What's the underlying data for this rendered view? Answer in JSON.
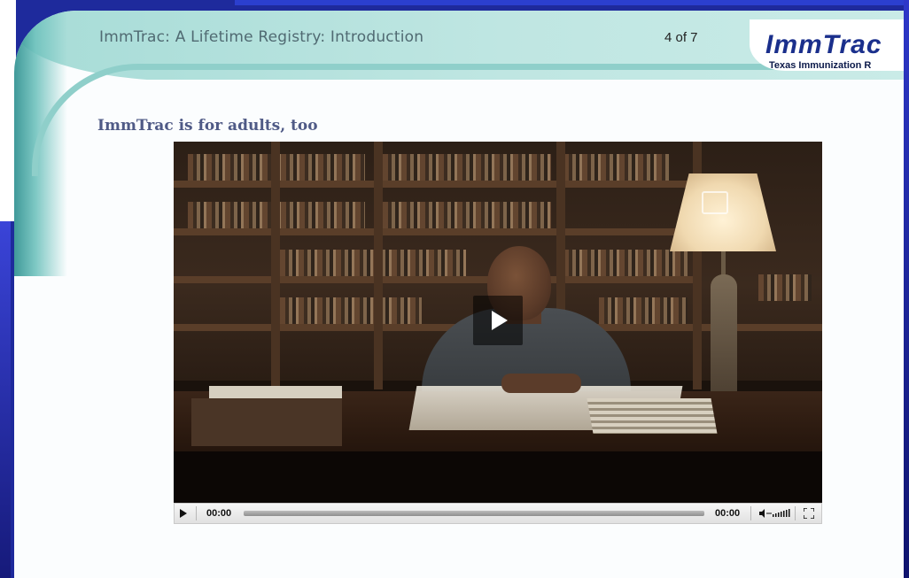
{
  "header": {
    "course_title": "ImmTrac: A Lifetime Registry: Introduction",
    "page_counter": "4 of 7",
    "logo_text": "ImmTrac",
    "logo_subtext": "Texas Immunization R"
  },
  "slide": {
    "heading": "ImmTrac is for adults, too"
  },
  "player": {
    "current_time": "00:00",
    "duration": "00:00",
    "progress": 0
  },
  "icons": {
    "play_overlay": "play-icon",
    "play_control": "play-icon",
    "volume": "volume-icon",
    "fullscreen": "fullscreen-icon"
  },
  "colors": {
    "header_band": "#bfe6e2",
    "heading_text": "#4f5a86",
    "logo_blue": "#1a2f8c",
    "app_background": "#1e2a9c"
  }
}
